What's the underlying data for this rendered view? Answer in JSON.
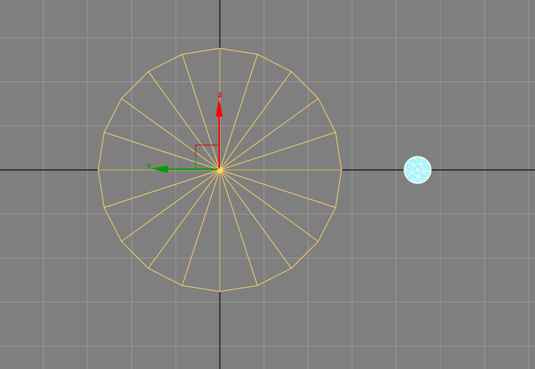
{
  "viewport": {
    "background_color": "#7f7f7f",
    "grid_color": "#9a9a9a",
    "world_axis_color": "#000000"
  },
  "selected_object": {
    "kind": "cone",
    "radial_segments": 20,
    "wire_color": "#ffd966"
  },
  "secondary_object": {
    "kind": "geosphere",
    "wire_color": "#ffffff",
    "fill_color": "#a6f4f8"
  },
  "gizmo": {
    "vertical_axis_label": "Z",
    "horizontal_axis_label": "Y",
    "vertical_axis_color": "#ff0000",
    "horizontal_axis_color": "#00a000",
    "plane_handle_color_vertical": "#d00000",
    "plane_handle_color_horizontal": "#00a000"
  }
}
